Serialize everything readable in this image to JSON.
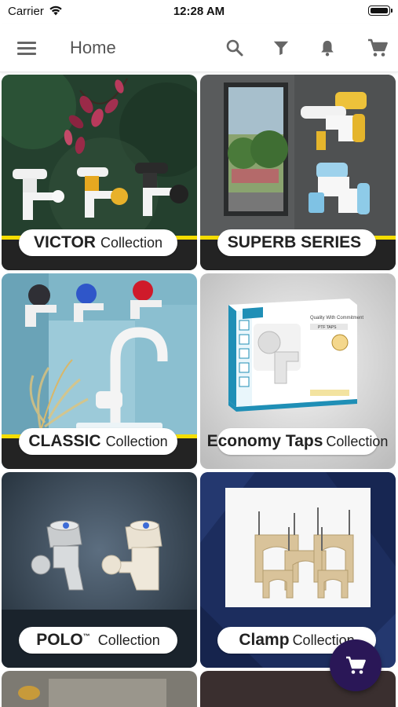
{
  "status_bar": {
    "carrier": "Carrier",
    "time": "12:28 AM"
  },
  "app_bar": {
    "title": "Home",
    "icons": [
      "menu-icon",
      "search-icon",
      "filter-icon",
      "bell-icon",
      "cart-icon"
    ]
  },
  "collections": [
    {
      "name": "VICTOR",
      "suffix": "Collection"
    },
    {
      "name": "SUPERB SERIES",
      "suffix": ""
    },
    {
      "name": "CLASSIC",
      "suffix": "Collection"
    },
    {
      "name": "Economy Taps",
      "suffix": "Collection"
    },
    {
      "name": "POLO",
      "tm": "™",
      "suffix": "Collection"
    },
    {
      "name": "Clamp",
      "suffix": "Collection"
    }
  ],
  "product_box": {
    "top_text": "Quality With Commitment",
    "label": "PTF TAPS"
  },
  "colors": {
    "accent": "#2a1757",
    "stripe_yellow": "#f4dd00",
    "stripe_dark": "#232323"
  },
  "fab": {
    "icon": "cart-icon"
  }
}
